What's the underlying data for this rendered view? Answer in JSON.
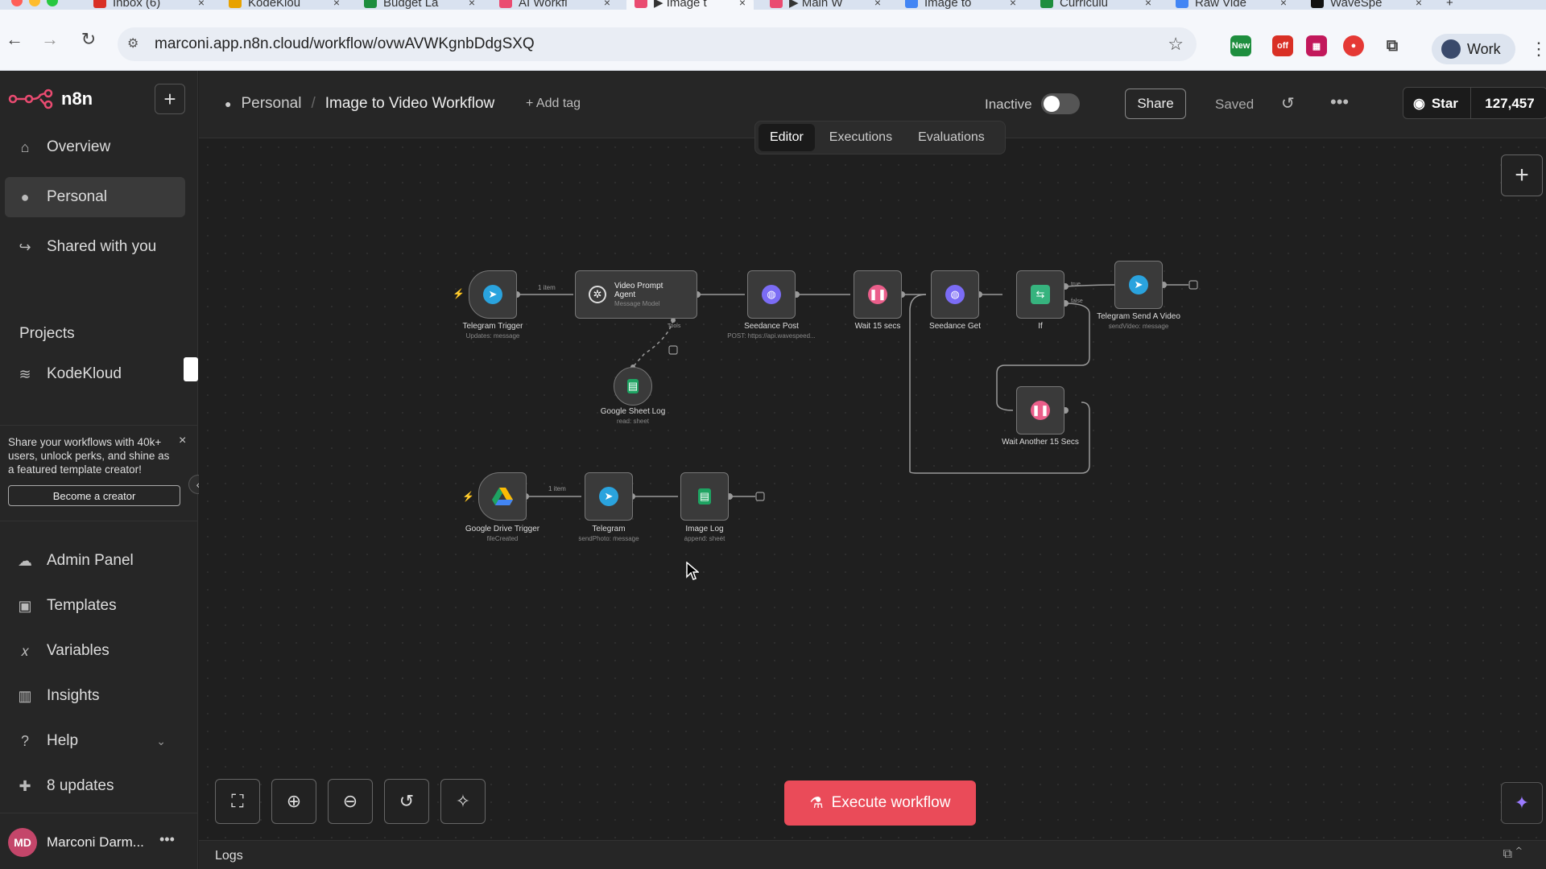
{
  "browser": {
    "tabs": [
      {
        "label": "Inbox (6)",
        "color": "#d93025"
      },
      {
        "label": "KodeKlou",
        "color": "#e8a200"
      },
      {
        "label": "Budget La",
        "color": "#1e8e3e"
      },
      {
        "label": "AI Workfl",
        "color": "#ea4b71"
      },
      {
        "label": "▶ Image t",
        "color": "#ea4b71",
        "active": true
      },
      {
        "label": "▶ Main W",
        "color": "#ea4b71"
      },
      {
        "label": "Image to",
        "color": "#4285f4"
      },
      {
        "label": "Curriculu",
        "color": "#1e8e3e"
      },
      {
        "label": "Raw Vide",
        "color": "#4285f4"
      },
      {
        "label": "WaveSpe",
        "color": "#111111"
      }
    ],
    "url": "marconi.app.n8n.cloud/workflow/ovwAVWKgnbDdgSXQ",
    "profile_label": "Work",
    "ext_new_badge": "New",
    "ext_off_badge": "off"
  },
  "sidebar": {
    "brand": "n8n",
    "items": [
      {
        "label": "Overview",
        "icon": "home-icon",
        "glyph": "⌂"
      },
      {
        "label": "Personal",
        "icon": "user-icon",
        "glyph": "👤"
      },
      {
        "label": "Shared with you",
        "icon": "share-icon",
        "glyph": "↪"
      }
    ],
    "projects_title": "Projects",
    "projects": [
      {
        "label": "KodeKloud",
        "icon": "layers-icon",
        "glyph": "≋"
      }
    ],
    "promo": {
      "text": "Share your workflows with 40k+ users, unlock perks, and shine as a featured template creator!",
      "button": "Become a creator"
    },
    "bottom_items": [
      {
        "label": "Admin Panel",
        "icon": "cloud-icon",
        "glyph": "☁"
      },
      {
        "label": "Templates",
        "icon": "box-icon",
        "glyph": "▣"
      },
      {
        "label": "Variables",
        "icon": "variable-icon",
        "glyph": "x"
      },
      {
        "label": "Insights",
        "icon": "chart-icon",
        "glyph": "▥"
      },
      {
        "label": "Help",
        "icon": "help-icon",
        "glyph": "?"
      },
      {
        "label": "8 updates",
        "icon": "gift-icon",
        "glyph": "🎁"
      }
    ],
    "user": {
      "initials": "MD",
      "name": "Marconi Darm..."
    }
  },
  "header": {
    "project": "Personal",
    "workflow_name": "Image to Video Workflow",
    "add_tag": "+ Add tag",
    "status_label": "Inactive",
    "active": false,
    "share": "Share",
    "saved": "Saved",
    "github_star": "Star",
    "github_count": "127,457"
  },
  "canvas": {
    "tabs": [
      "Editor",
      "Executions",
      "Evaluations"
    ],
    "active_tab": "Editor",
    "nodes": {
      "telegram_trigger": {
        "label": "Telegram Trigger",
        "sub": "Updates: message"
      },
      "video_prompt_agent": {
        "label": "Video Prompt Agent",
        "sub": "Message Model"
      },
      "seedance_post": {
        "label": "Seedance Post",
        "sub": "POST: https://api.wavespeed..."
      },
      "wait_15": {
        "label": "Wait 15 secs",
        "sub": ""
      },
      "seedance_get": {
        "label": "Seedance Get",
        "sub": ""
      },
      "if_node": {
        "label": "If",
        "sub": ""
      },
      "telegram_send_video": {
        "label": "Telegram Send A Video",
        "sub": "sendVideo: message"
      },
      "google_sheet_log": {
        "label": "Google Sheet Log",
        "sub": "read: sheet"
      },
      "wait_another_15": {
        "label": "Wait Another 15 Secs",
        "sub": ""
      },
      "google_drive_trigger": {
        "label": "Google Drive Trigger",
        "sub": "fileCreated"
      },
      "telegram": {
        "label": "Telegram",
        "sub": "sendPhoto: message"
      },
      "image_log": {
        "label": "Image Log",
        "sub": "append: sheet"
      }
    },
    "edge_labels": {
      "item1_a": "1 item",
      "item1_b": "1 item",
      "tools": "Tools",
      "true": "true",
      "false": "false"
    },
    "execute_button": "Execute workflow",
    "colors": {
      "accent": "#ea4b59",
      "telegram": "#2aa3de",
      "sheets": "#1ea362",
      "wait": "#ea5e8a",
      "http": "#7b6cf5",
      "if": "#36b37e"
    }
  },
  "logs": {
    "label": "Logs"
  }
}
